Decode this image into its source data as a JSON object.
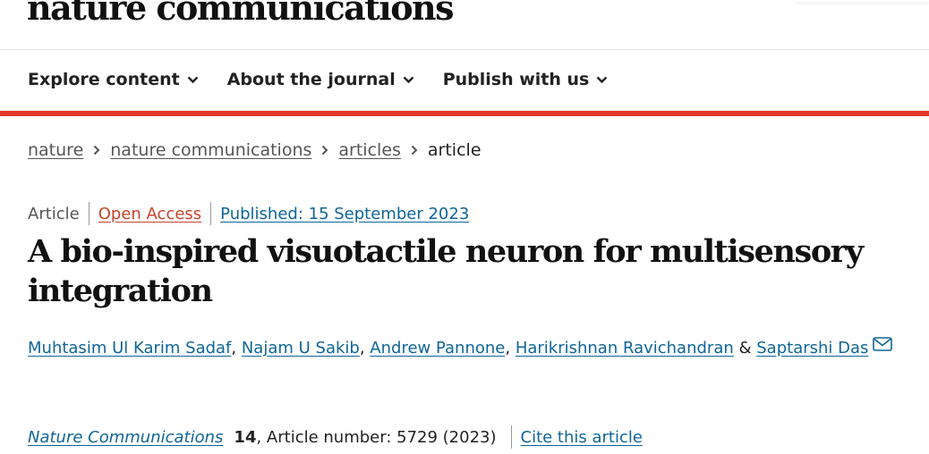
{
  "header": {
    "brand": "nature communications"
  },
  "nav": {
    "items": [
      {
        "label": "Explore content"
      },
      {
        "label": "About the journal"
      },
      {
        "label": "Publish with us"
      }
    ]
  },
  "breadcrumb": {
    "items": [
      "nature",
      "nature communications",
      "articles"
    ],
    "current": "article"
  },
  "article": {
    "type": "Article",
    "access": "Open Access",
    "published": "Published: 15 September 2023",
    "title": "A bio-inspired visuotactile neuron for multisensory integration",
    "authors": [
      "Muhtasim Ul Karim Sadaf",
      "Najam U Sakib",
      "Andrew Pannone",
      "Harikrishnan Ravichandran",
      "Saptarshi Das"
    ],
    "author_separator": ", ",
    "author_and": " & ",
    "journal": "Nature Communications",
    "volume": "14",
    "article_number": ", Article number: 5729 (2023)",
    "cite_label": "Cite this article"
  },
  "colors": {
    "accent_red": "#e4352b",
    "link_blue": "#0f6599",
    "open_access": "#c4442a"
  },
  "icons": {
    "nav_chevron": "chevron-down-icon",
    "breadcrumb_sep": "chevron-right-icon",
    "author_contact": "mail-icon"
  }
}
